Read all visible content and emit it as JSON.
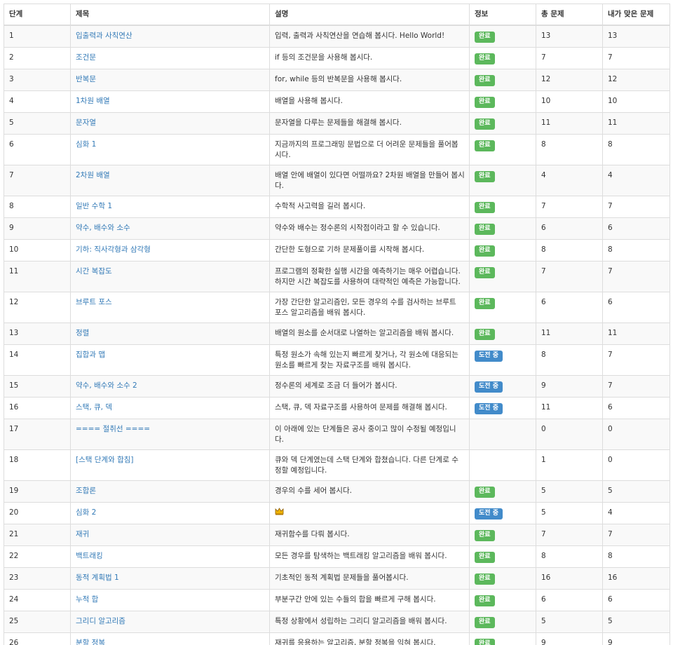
{
  "colors": {
    "done_badge": "#5cb85c",
    "trying_badge": "#428bca",
    "link": "#337ab7"
  },
  "table": {
    "headers": [
      "단계",
      "제목",
      "설명",
      "정보",
      "총 문제",
      "내가 맞은 문제"
    ],
    "rows": [
      {
        "step": "1",
        "title": "입출력과 사칙연산",
        "desc": "입력, 출력과 사칙연산을 연습해 봅시다. Hello World!",
        "status": "완료",
        "status_kind": "done",
        "total": "13",
        "solved": "13"
      },
      {
        "step": "2",
        "title": "조건문",
        "desc": "if 등의 조건문을 사용해 봅시다.",
        "status": "완료",
        "status_kind": "done",
        "total": "7",
        "solved": "7"
      },
      {
        "step": "3",
        "title": "반복문",
        "desc": "for, while 등의 반복문을 사용해 봅시다.",
        "status": "완료",
        "status_kind": "done",
        "total": "12",
        "solved": "12"
      },
      {
        "step": "4",
        "title": "1차원 배열",
        "desc": "배열을 사용해 봅시다.",
        "status": "완료",
        "status_kind": "done",
        "total": "10",
        "solved": "10"
      },
      {
        "step": "5",
        "title": "문자열",
        "desc": "문자열을 다루는 문제들을 해결해 봅시다.",
        "status": "완료",
        "status_kind": "done",
        "total": "11",
        "solved": "11"
      },
      {
        "step": "6",
        "title": "심화 1",
        "desc": "지금까지의 프로그래밍 문법으로 더 어려운 문제들을 풀어봅시다.",
        "status": "완료",
        "status_kind": "done",
        "total": "8",
        "solved": "8"
      },
      {
        "step": "7",
        "title": "2차원 배열",
        "desc": "배열 안에 배열이 있다면 어떨까요? 2차원 배열을 만들어 봅시다.",
        "status": "완료",
        "status_kind": "done",
        "total": "4",
        "solved": "4"
      },
      {
        "step": "8",
        "title": "일반 수학 1",
        "desc": "수학적 사고력을 길러 봅시다.",
        "status": "완료",
        "status_kind": "done",
        "total": "7",
        "solved": "7"
      },
      {
        "step": "9",
        "title": "약수, 배수와 소수",
        "desc": "약수와 배수는 정수론의 시작점이라고 할 수 있습니다.",
        "status": "완료",
        "status_kind": "done",
        "total": "6",
        "solved": "6"
      },
      {
        "step": "10",
        "title": "기하: 직사각형과 삼각형",
        "desc": "간단한 도형으로 기하 문제풀이를 시작해 봅시다.",
        "status": "완료",
        "status_kind": "done",
        "total": "8",
        "solved": "8"
      },
      {
        "step": "11",
        "title": "시간 복잡도",
        "desc": "프로그램의 정확한 실행 시간을 예측하기는 매우 어렵습니다. 하지만 시간 복잡도를 사용하여 대략적인 예측은 가능합니다.",
        "status": "완료",
        "status_kind": "done",
        "total": "7",
        "solved": "7"
      },
      {
        "step": "12",
        "title": "브루트 포스",
        "desc": "가장 간단한 알고리즘인, 모든 경우의 수를 검사하는 브루트 포스 알고리즘을 배워 봅시다.",
        "status": "완료",
        "status_kind": "done",
        "total": "6",
        "solved": "6"
      },
      {
        "step": "13",
        "title": "정렬",
        "desc": "배열의 원소를 순서대로 나열하는 알고리즘을 배워 봅시다.",
        "status": "완료",
        "status_kind": "done",
        "total": "11",
        "solved": "11"
      },
      {
        "step": "14",
        "title": "집합과 맵",
        "desc": "특정 원소가 속해 있는지 빠르게 찾거나, 각 원소에 대응되는 원소를 빠르게 찾는 자료구조를 배워 봅시다.",
        "status": "도전 중",
        "status_kind": "trying",
        "total": "8",
        "solved": "7"
      },
      {
        "step": "15",
        "title": "약수, 배수와 소수 2",
        "desc": "정수론의 세계로 조금 더 들어가 봅시다.",
        "status": "도전 중",
        "status_kind": "trying",
        "total": "9",
        "solved": "7"
      },
      {
        "step": "16",
        "title": "스택, 큐, 덱",
        "desc": "스택, 큐, 덱 자료구조를 사용하여 문제를 해결해 봅시다.",
        "status": "도전 중",
        "status_kind": "trying",
        "total": "11",
        "solved": "6"
      },
      {
        "step": "17",
        "title": "==== 절취선 ====",
        "desc": "이 아래에 있는 단계들은 공사 중이고 많이 수정될 예정입니다.",
        "status": "",
        "status_kind": "none",
        "total": "0",
        "solved": "0"
      },
      {
        "step": "18",
        "title": "[스택 단계와 합침]",
        "desc": "큐와 덱 단계였는데 스택 단계와 합쳤습니다. 다른 단계로 수정할 예정입니다.",
        "status": "",
        "status_kind": "none",
        "total": "1",
        "solved": "0"
      },
      {
        "step": "19",
        "title": "조합론",
        "desc": "경우의 수를 세어 봅시다.",
        "status": "완료",
        "status_kind": "done",
        "total": "5",
        "solved": "5"
      },
      {
        "step": "20",
        "title": "심화 2",
        "desc": "",
        "desc_icon": "crown-icon",
        "status": "도전 중",
        "status_kind": "trying",
        "total": "5",
        "solved": "4"
      },
      {
        "step": "21",
        "title": "재귀",
        "desc": "재귀함수를 다뤄 봅시다.",
        "status": "완료",
        "status_kind": "done",
        "total": "7",
        "solved": "7"
      },
      {
        "step": "22",
        "title": "백트래킹",
        "desc": "모든 경우를 탐색하는 백트래킹 알고리즘을 배워 봅시다.",
        "status": "완료",
        "status_kind": "done",
        "total": "8",
        "solved": "8"
      },
      {
        "step": "23",
        "title": "동적 계획법 1",
        "desc": "기초적인 동적 계획법 문제들을 풀어봅시다.",
        "status": "완료",
        "status_kind": "done",
        "total": "16",
        "solved": "16"
      },
      {
        "step": "24",
        "title": "누적 합",
        "desc": "부분구간 안에 있는 수들의 합을 빠르게 구해 봅시다.",
        "status": "완료",
        "status_kind": "done",
        "total": "6",
        "solved": "6"
      },
      {
        "step": "25",
        "title": "그리디 알고리즘",
        "desc": "특정 상황에서 성립하는 그리디 알고리즘을 배워 봅시다.",
        "status": "완료",
        "status_kind": "done",
        "total": "5",
        "solved": "5"
      },
      {
        "step": "26",
        "title": "분할 정복",
        "desc": "재귀를 응용하는 알고리즘, 분할 정복을 익혀 봅시다.",
        "status": "완료",
        "status_kind": "done",
        "total": "9",
        "solved": "9"
      }
    ]
  }
}
